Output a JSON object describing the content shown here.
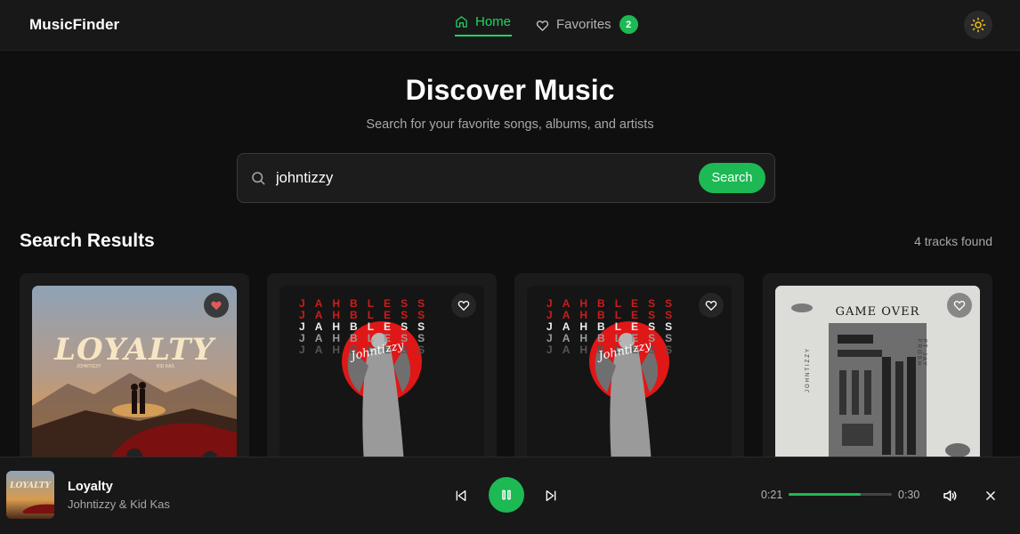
{
  "header": {
    "brand": "MusicFinder",
    "nav": {
      "home": "Home",
      "favorites": "Favorites",
      "favorites_count": "2"
    },
    "icons": {
      "home": "home-icon",
      "favorites": "heart-icon",
      "theme": "sun-icon"
    }
  },
  "hero": {
    "title": "Discover Music",
    "subtitle": "Search for your favorite songs, albums, and artists"
  },
  "search": {
    "value": "johntizzy",
    "button": "Search",
    "icon": "search-icon"
  },
  "results": {
    "title": "Search Results",
    "count": "4 tracks found",
    "cards": [
      {
        "art_title": "LOYALTY",
        "art_artist_left": "JOHNTIZZY",
        "art_artist_right": "KID KAS",
        "favorited": true
      },
      {
        "art_letters": [
          "J",
          "A",
          "H",
          "B",
          "L",
          "E",
          "S",
          "S"
        ],
        "art_script": "Johntizzy",
        "favorited": false
      },
      {
        "art_letters": [
          "J",
          "A",
          "H",
          "B",
          "L",
          "E",
          "S",
          "S"
        ],
        "art_script": "Johntizzy",
        "favorited": false
      },
      {
        "art_title": "GAME OVER",
        "art_side_left": "JOHNTIZZY",
        "art_side_right": "FT JAY FROSH",
        "favorited": false
      }
    ]
  },
  "player": {
    "title": "Loyalty",
    "artist": "Johntizzy & Kid Kas",
    "thumb_text": "LOYALTY",
    "current_time": "0:21",
    "total_time": "0:30",
    "progress": 0.7,
    "state": "playing"
  },
  "colors": {
    "accent": "#1db954",
    "favorite": "#e05a5a",
    "background": "#0f0f0f"
  }
}
